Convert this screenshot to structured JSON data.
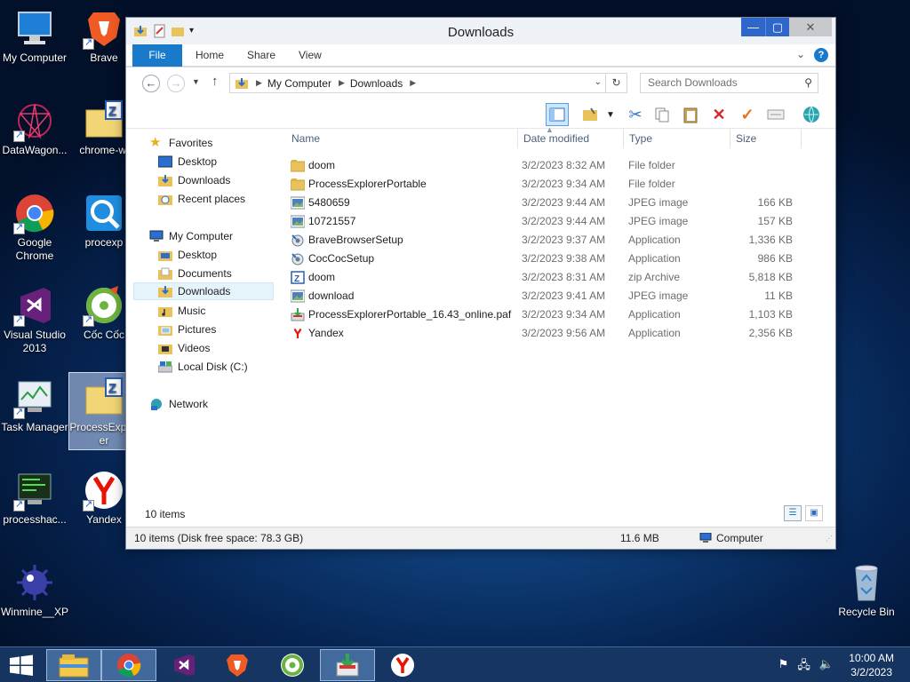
{
  "desktop": {
    "icons": [
      {
        "label": "My Computer"
      },
      {
        "label": "Brave"
      },
      {
        "label": "DataWagon..."
      },
      {
        "label": "chrome-wi"
      },
      {
        "label": "Google Chrome"
      },
      {
        "label": "procexp"
      },
      {
        "label": "Visual Studio 2013"
      },
      {
        "label": "Cốc Cốc"
      },
      {
        "label": "Task Manager"
      },
      {
        "label": "ProcessExplorer"
      },
      {
        "label": "processhac..."
      },
      {
        "label": "Yandex"
      },
      {
        "label": "Winmine__XP"
      },
      {
        "label": "Recycle Bin"
      }
    ]
  },
  "window": {
    "title": "Downloads",
    "ribbon_tabs": [
      "File",
      "Home",
      "Share",
      "View"
    ],
    "address": {
      "crumbs": [
        "My Computer",
        "Downloads"
      ]
    },
    "search_placeholder": "Search Downloads",
    "nav": {
      "favorites": "Favorites",
      "fav_items": [
        "Desktop",
        "Downloads",
        "Recent places"
      ],
      "computer": "My Computer",
      "computer_items": [
        "Desktop",
        "Documents",
        "Downloads",
        "Music",
        "Pictures",
        "Videos",
        "Local Disk (C:)"
      ],
      "network": "Network"
    },
    "columns": [
      "Name",
      "Date modified",
      "Type",
      "Size"
    ],
    "files": [
      {
        "name": "doom",
        "date": "3/2/2023 8:32 AM",
        "type": "File folder",
        "size": "",
        "icon": "folder-icon"
      },
      {
        "name": "ProcessExplorerPortable",
        "date": "3/2/2023 9:34 AM",
        "type": "File folder",
        "size": "",
        "icon": "folder-icon"
      },
      {
        "name": "5480659",
        "date": "3/2/2023 9:44 AM",
        "type": "JPEG image",
        "size": "166 KB",
        "icon": "image-icon"
      },
      {
        "name": "10721557",
        "date": "3/2/2023 9:44 AM",
        "type": "JPEG image",
        "size": "157 KB",
        "icon": "image-icon"
      },
      {
        "name": "BraveBrowserSetup",
        "date": "3/2/2023 9:37 AM",
        "type": "Application",
        "size": "1,336 KB",
        "icon": "setup-icon"
      },
      {
        "name": "CocCocSetup",
        "date": "3/2/2023 9:38 AM",
        "type": "Application",
        "size": "986 KB",
        "icon": "setup-icon"
      },
      {
        "name": "doom",
        "date": "3/2/2023 8:31 AM",
        "type": "zip Archive",
        "size": "5,818 KB",
        "icon": "zip-icon"
      },
      {
        "name": "download",
        "date": "3/2/2023 9:41 AM",
        "type": "JPEG image",
        "size": "11 KB",
        "icon": "image-icon"
      },
      {
        "name": "ProcessExplorerPortable_16.43_online.paf",
        "date": "3/2/2023 9:34 AM",
        "type": "Application",
        "size": "1,103 KB",
        "icon": "installer-icon"
      },
      {
        "name": "Yandex",
        "date": "3/2/2023 9:56 AM",
        "type": "Application",
        "size": "2,356 KB",
        "icon": "yandex-icon"
      }
    ],
    "item_count": "10 items",
    "status": {
      "left": "10 items (Disk free space: 78.3 GB)",
      "size": "11.6 MB",
      "location": "Computer"
    }
  },
  "taskbar": {
    "time": "10:00 AM",
    "date": "3/2/2023"
  }
}
